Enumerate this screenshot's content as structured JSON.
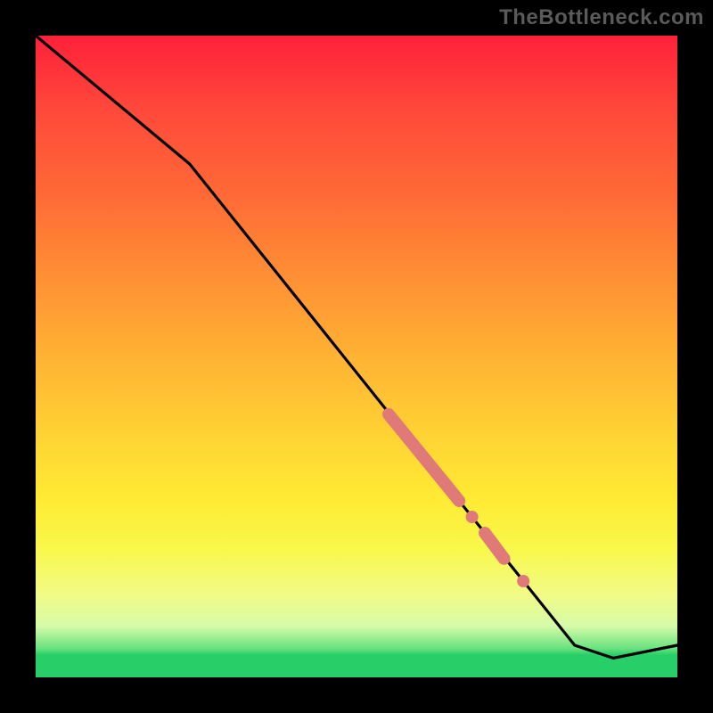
{
  "watermark": "TheBottleneck.com",
  "chart_data": {
    "type": "line",
    "title": "",
    "xlabel": "",
    "ylabel": "",
    "xlim": [
      0,
      100
    ],
    "ylim": [
      0,
      100
    ],
    "grid": false,
    "legend": false,
    "series": [
      {
        "name": "curve",
        "color": "#000000",
        "x": [
          0,
          24,
          84,
          90,
          100
        ],
        "y": [
          100,
          80,
          5,
          3,
          5
        ]
      }
    ],
    "markers": [
      {
        "name": "highlight-segment-1",
        "shape": "thick-round-segment",
        "color": "#e07a78",
        "x_start": 55,
        "y_start": 41,
        "x_end": 66,
        "y_end": 27.5
      },
      {
        "name": "highlight-dot-1",
        "shape": "dot",
        "color": "#e07a78",
        "x": 68,
        "y": 25
      },
      {
        "name": "highlight-segment-2",
        "shape": "thick-round-segment",
        "color": "#e07a78",
        "x_start": 70,
        "y_start": 22.5,
        "x_end": 73,
        "y_end": 18.5
      },
      {
        "name": "highlight-dot-2",
        "shape": "dot",
        "color": "#e07a78",
        "x": 76,
        "y": 15
      }
    ],
    "background_gradient_stops": [
      {
        "pos": 0.0,
        "color": "#ff203a"
      },
      {
        "pos": 0.5,
        "color": "#ffb233"
      },
      {
        "pos": 0.8,
        "color": "#f8f84a"
      },
      {
        "pos": 0.96,
        "color": "#28cf68"
      },
      {
        "pos": 1.0,
        "color": "#28cf68"
      }
    ]
  }
}
